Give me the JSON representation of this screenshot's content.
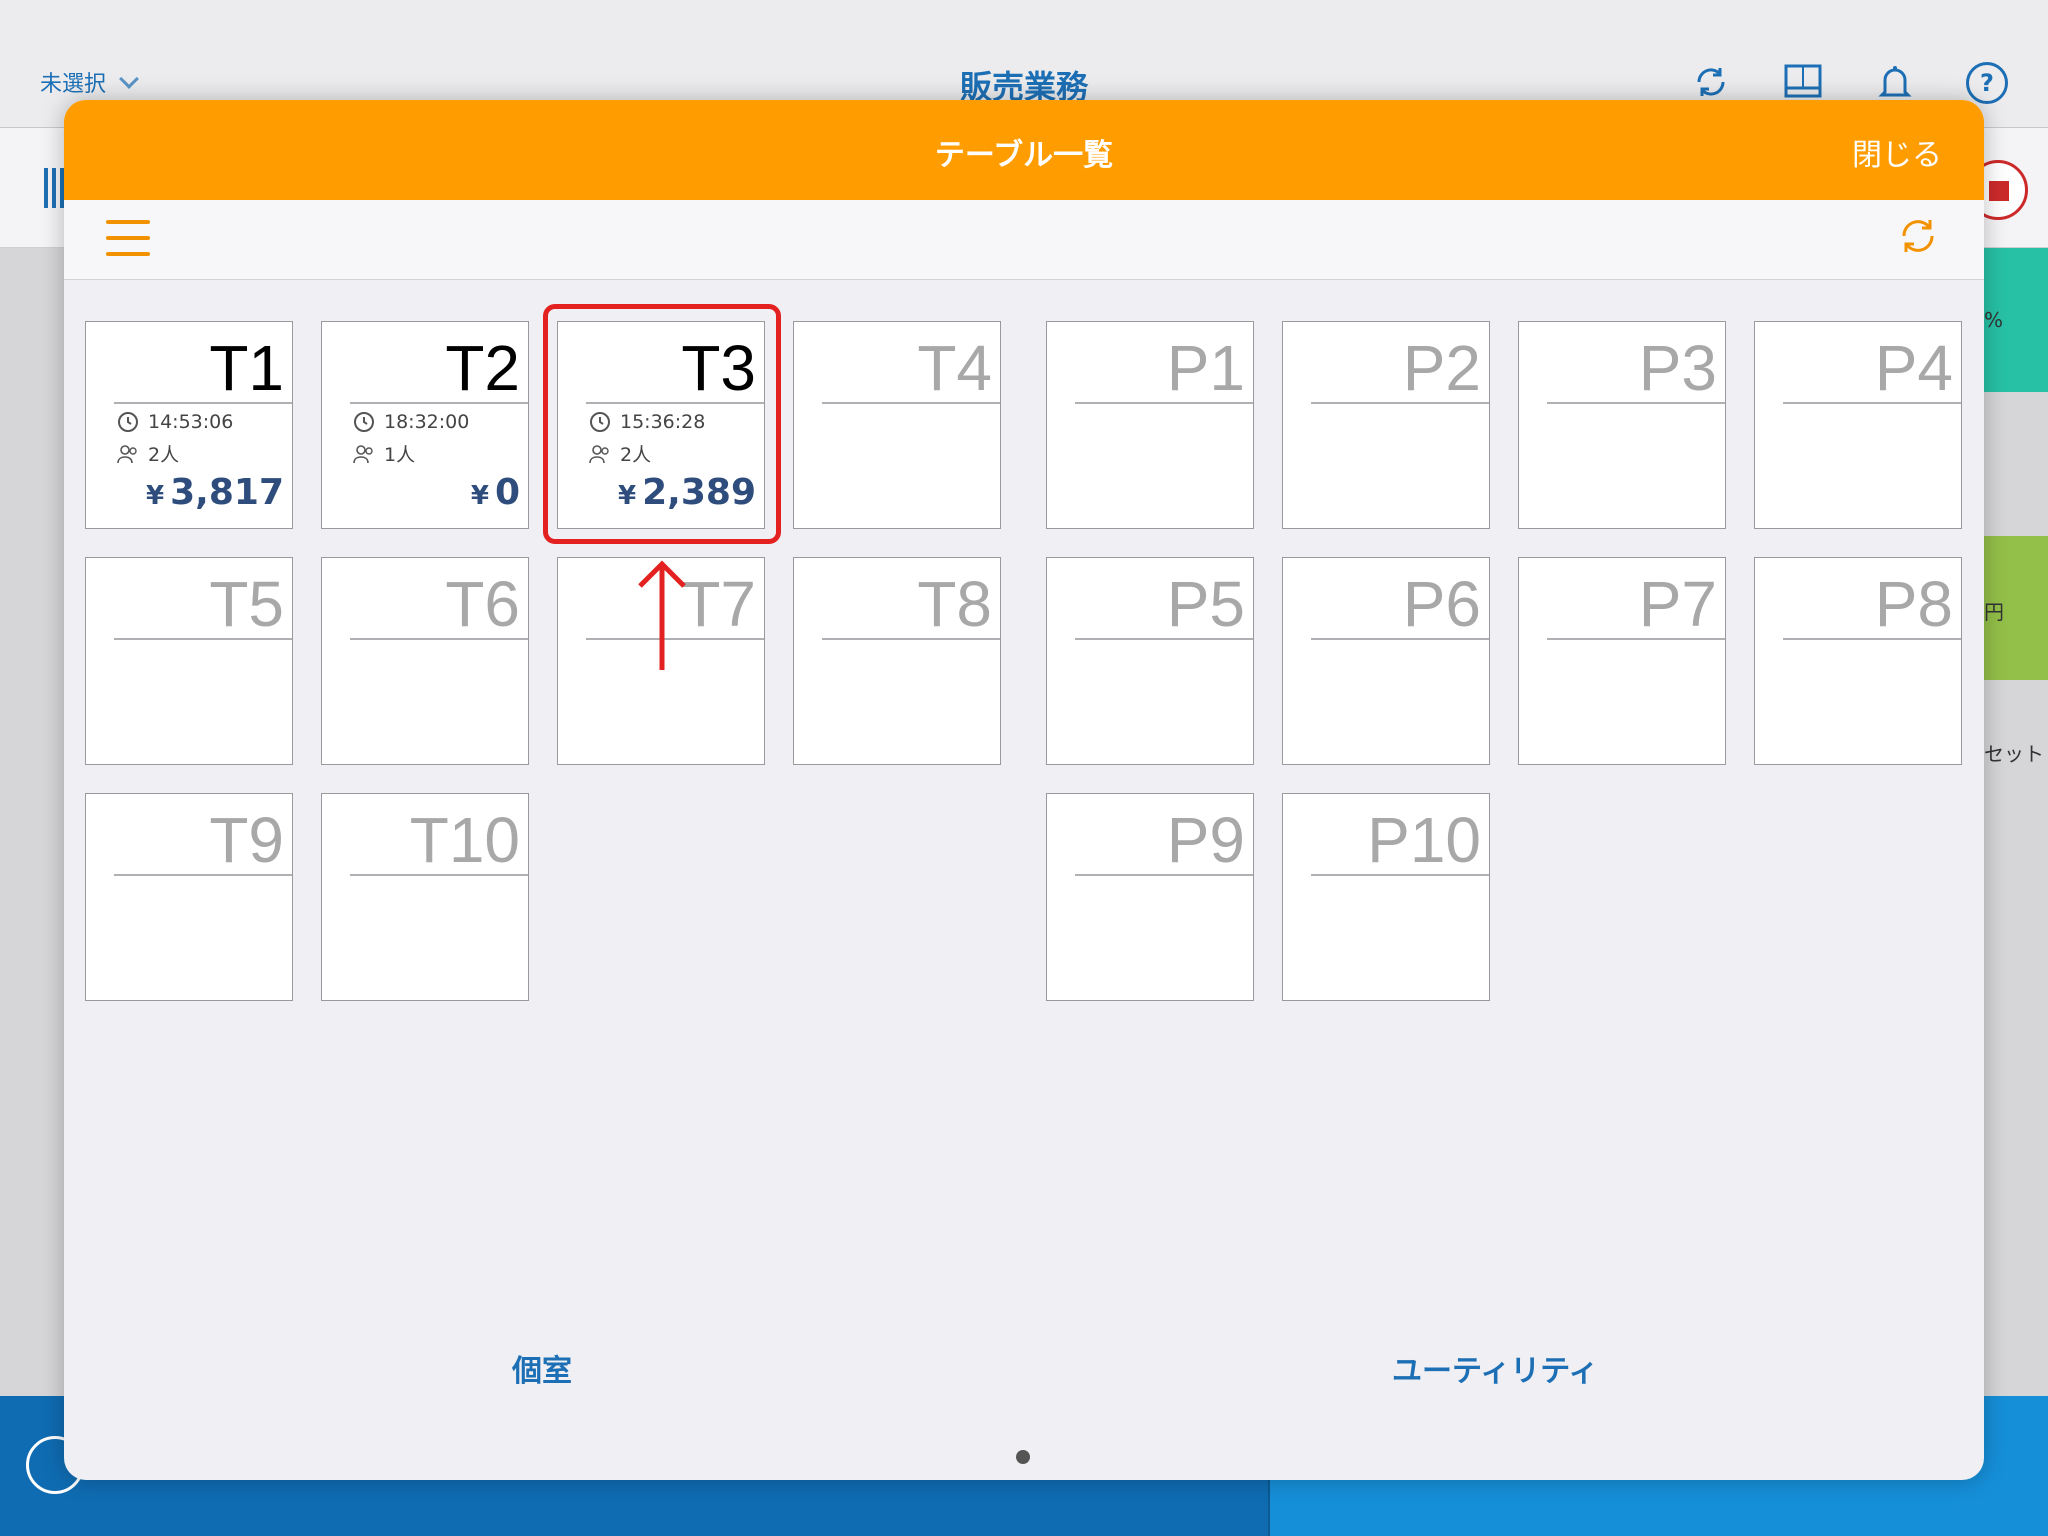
{
  "background": {
    "store_select": "未選択",
    "title": "販売業務",
    "side_labels": [
      "%",
      "円",
      "セット"
    ]
  },
  "modal": {
    "title": "テーブル一覧",
    "close_label": "閉じる",
    "tables": [
      {
        "label": "T1",
        "time": "14:53:06",
        "guests": "2人",
        "currency": "¥",
        "amount": "3,817",
        "occupied": true
      },
      {
        "label": "T2",
        "time": "18:32:00",
        "guests": "1人",
        "currency": "¥",
        "amount": "0",
        "occupied": true
      },
      {
        "label": "T3",
        "time": "15:36:28",
        "guests": "2人",
        "currency": "¥",
        "amount": "2,389",
        "occupied": true
      },
      {
        "label": "T4",
        "occupied": false
      },
      {
        "label": "T5",
        "occupied": false
      },
      {
        "label": "T6",
        "occupied": false
      },
      {
        "label": "T7",
        "occupied": false
      },
      {
        "label": "T8",
        "occupied": false
      },
      {
        "label": "T9",
        "occupied": false
      },
      {
        "label": "T10",
        "occupied": false
      }
    ],
    "private_rooms": [
      {
        "label": "P1"
      },
      {
        "label": "P2"
      },
      {
        "label": "P3"
      },
      {
        "label": "P4"
      },
      {
        "label": "P5"
      },
      {
        "label": "P6"
      },
      {
        "label": "P7"
      },
      {
        "label": "P8"
      },
      {
        "label": "P9"
      },
      {
        "label": "P10"
      }
    ],
    "bottom_tabs": [
      "個室",
      "ユーティリティ"
    ]
  },
  "colors": {
    "header_orange": "#ff9c00",
    "accent_blue": "#1d6fb5",
    "amount_navy": "#2f4d7c",
    "highlight_red": "#e32121"
  }
}
